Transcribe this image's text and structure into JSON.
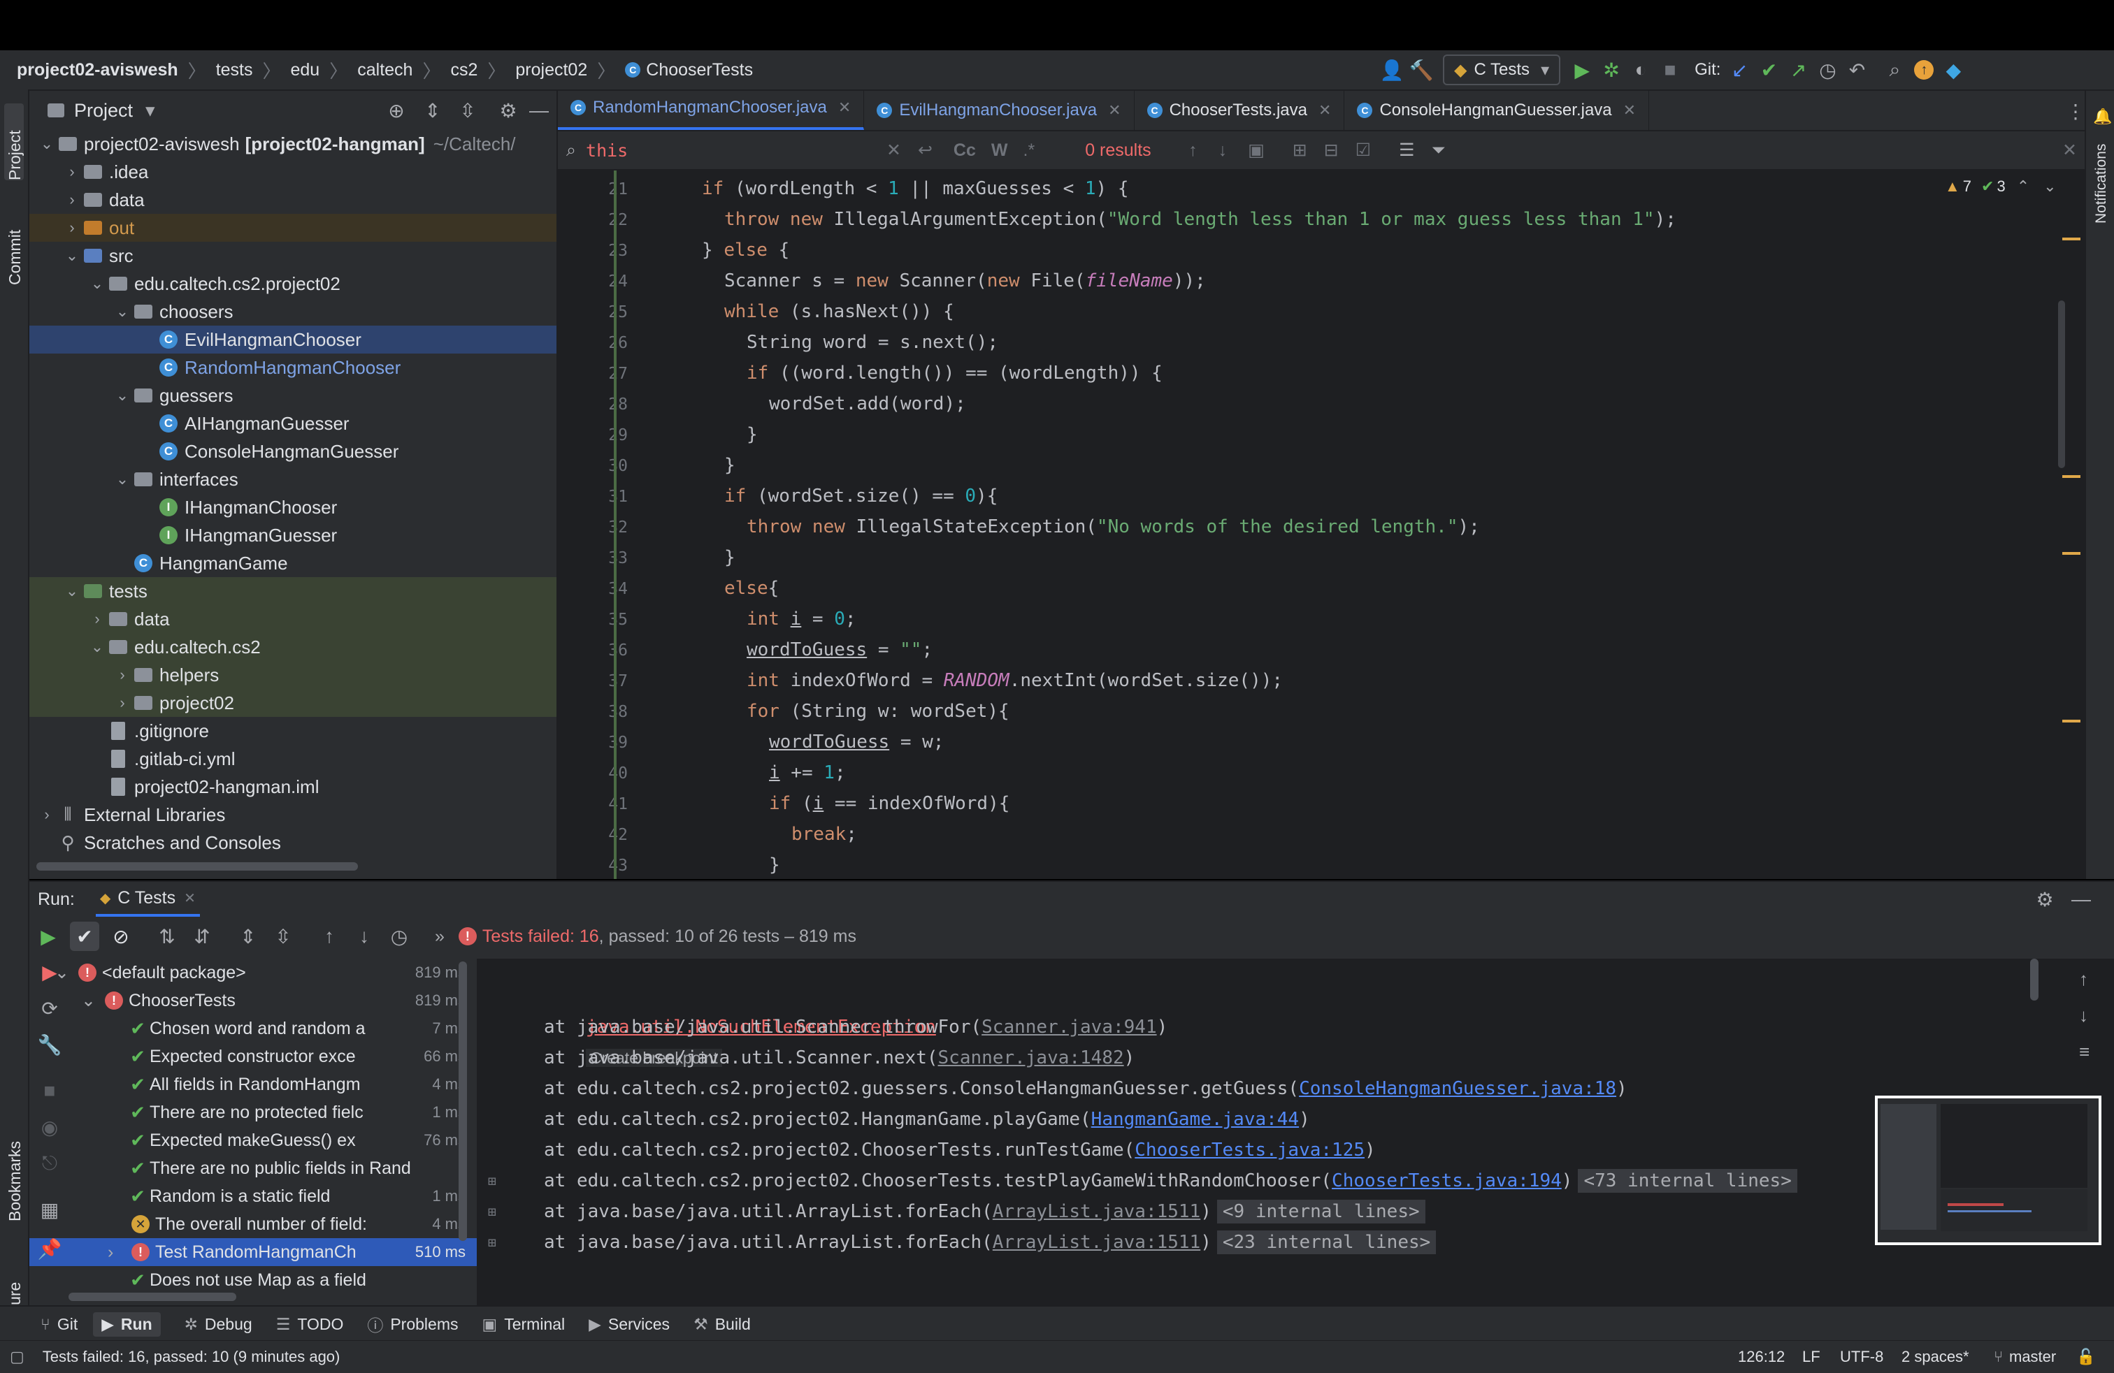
{
  "colors": {
    "accent": "#3574f0",
    "error": "#db5c5c",
    "success": "#5fb85a",
    "background": "#1e1f22",
    "panel": "#2b2d30"
  },
  "navbar": {
    "crumbs": [
      "project02-aviswesh",
      "tests",
      "edu",
      "caltech",
      "cs2",
      "project02",
      "ChooserTests"
    ],
    "run_config": "C Tests",
    "git_label": "Git:"
  },
  "left_strip": {
    "project": "Project",
    "commit": "Commit",
    "bookmarks": "Bookmarks",
    "structure": "Structure"
  },
  "right_strip": {
    "notifications": "Notifications"
  },
  "project_panel": {
    "title": "Project",
    "tree": [
      {
        "label": "project02-aviswesh",
        "extra": "[project02-hangman]",
        "path": "~/Caltech/",
        "indent": 0,
        "chev": "v",
        "icon": "folder"
      },
      {
        "label": ".idea",
        "indent": 1,
        "chev": ">",
        "icon": "folder"
      },
      {
        "label": "data",
        "indent": 1,
        "chev": ">",
        "icon": "folder"
      },
      {
        "label": "out",
        "indent": 1,
        "chev": ">",
        "icon": "folder-orange"
      },
      {
        "label": "src",
        "indent": 1,
        "chev": "v",
        "icon": "folder-blue"
      },
      {
        "label": "edu.caltech.cs2.project02",
        "indent": 2,
        "chev": "v",
        "icon": "folder"
      },
      {
        "label": "choosers",
        "indent": 3,
        "chev": "v",
        "icon": "folder"
      },
      {
        "label": "EvilHangmanChooser",
        "indent": 4,
        "chev": "",
        "icon": "class"
      },
      {
        "label": "RandomHangmanChooser",
        "indent": 4,
        "chev": "",
        "icon": "class"
      },
      {
        "label": "guessers",
        "indent": 3,
        "chev": "v",
        "icon": "folder"
      },
      {
        "label": "AIHangmanGuesser",
        "indent": 4,
        "chev": "",
        "icon": "class"
      },
      {
        "label": "ConsoleHangmanGuesser",
        "indent": 4,
        "chev": "",
        "icon": "class"
      },
      {
        "label": "interfaces",
        "indent": 3,
        "chev": "v",
        "icon": "folder"
      },
      {
        "label": "IHangmanChooser",
        "indent": 4,
        "chev": "",
        "icon": "interface"
      },
      {
        "label": "IHangmanGuesser",
        "indent": 4,
        "chev": "",
        "icon": "interface"
      },
      {
        "label": "HangmanGame",
        "indent": 3,
        "chev": "",
        "icon": "class"
      },
      {
        "label": "tests",
        "indent": 1,
        "chev": "v",
        "icon": "folder-green"
      },
      {
        "label": "data",
        "indent": 2,
        "chev": ">",
        "icon": "folder"
      },
      {
        "label": "edu.caltech.cs2",
        "indent": 2,
        "chev": "v",
        "icon": "folder"
      },
      {
        "label": "helpers",
        "indent": 3,
        "chev": ">",
        "icon": "folder"
      },
      {
        "label": "project02",
        "indent": 3,
        "chev": ">",
        "icon": "folder"
      },
      {
        "label": ".gitignore",
        "indent": 2,
        "chev": "",
        "icon": "file"
      },
      {
        "label": ".gitlab-ci.yml",
        "indent": 2,
        "chev": "",
        "icon": "file"
      },
      {
        "label": "project02-hangman.iml",
        "indent": 2,
        "chev": "",
        "icon": "file"
      },
      {
        "label": "External Libraries",
        "indent": 0,
        "chev": ">",
        "icon": "lib"
      },
      {
        "label": "Scratches and Consoles",
        "indent": 0,
        "chev": "",
        "icon": "scratch"
      }
    ]
  },
  "editor": {
    "tabs": [
      {
        "label": "RandomHangmanChooser.java",
        "active": true
      },
      {
        "label": "EvilHangmanChooser.java",
        "active": false
      },
      {
        "label": "ChooserTests.java",
        "active": false
      },
      {
        "label": "ConsoleHangmanGuesser.java",
        "active": false
      }
    ],
    "search": {
      "query": "this",
      "results": "0 results",
      "case": "Cc",
      "word": "W",
      "regex": ".*"
    },
    "inspections": {
      "warnings": "7",
      "weak": "3"
    },
    "line_numbers": [
      "21",
      "22",
      "23",
      "24",
      "25",
      "26",
      "27",
      "28",
      "29",
      "30",
      "31",
      "32",
      "33",
      "34",
      "35",
      "36",
      "37",
      "38",
      "39",
      "40",
      "41",
      "42",
      "43"
    ]
  },
  "run_panel": {
    "label": "Run:",
    "tab": "C Tests",
    "summary_failed": "Tests failed: 16",
    "summary_rest": ", passed: 10 of 26 tests – 819 ms",
    "tests": [
      {
        "name": "<default package>",
        "time": "819 ms",
        "status": "error",
        "indent": 0
      },
      {
        "name": "ChooserTests",
        "time": "819 ms",
        "status": "error",
        "indent": 1
      },
      {
        "name": "Chosen word and random a",
        "time": "7 ms",
        "status": "pass",
        "indent": 2
      },
      {
        "name": "Expected constructor exce",
        "time": "66 ms",
        "status": "pass",
        "indent": 2
      },
      {
        "name": "All fields in RandomHangm",
        "time": "4 ms",
        "status": "pass",
        "indent": 2
      },
      {
        "name": "There are no protected fielc",
        "time": "1 ms",
        "status": "pass",
        "indent": 2
      },
      {
        "name": "Expected makeGuess() ex",
        "time": "76 ms",
        "status": "pass",
        "indent": 2
      },
      {
        "name": "There are no public fields in Rand",
        "time": "",
        "status": "pass",
        "indent": 2
      },
      {
        "name": "Random is a static field",
        "time": "1 ms",
        "status": "pass",
        "indent": 2
      },
      {
        "name": "The overall number of field:",
        "time": "4 ms",
        "status": "warn",
        "indent": 2
      },
      {
        "name": "Test RandomHangmanCh",
        "time": "510 ms",
        "status": "error",
        "indent": 2,
        "selected": true
      },
      {
        "name": "Does not use Map as a field",
        "time": "",
        "status": "pass",
        "indent": 2
      }
    ],
    "console": {
      "exception": "java.util.NoSuchElementException",
      "create_breakpoint": "Create breakpoint",
      "frames": [
        {
          "text": "at java.base/java.util.Scanner.throwFor(",
          "link": "Scanner.java:941",
          "end": ")",
          "hint": "",
          "own": false
        },
        {
          "text": "at java.base/java.util.Scanner.next(",
          "link": "Scanner.java:1482",
          "end": ")",
          "hint": "",
          "own": false
        },
        {
          "text": "at edu.caltech.cs2.project02.guessers.ConsoleHangmanGuesser.getGuess(",
          "link": "ConsoleHangmanGuesser.java:18",
          "end": ")",
          "hint": "",
          "own": true
        },
        {
          "text": "at edu.caltech.cs2.project02.HangmanGame.playGame(",
          "link": "HangmanGame.java:44",
          "end": ")",
          "hint": "",
          "own": true
        },
        {
          "text": "at edu.caltech.cs2.project02.ChooserTests.runTestGame(",
          "link": "ChooserTests.java:125",
          "end": ")",
          "hint": "",
          "own": true
        },
        {
          "text": "at edu.caltech.cs2.project02.ChooserTests.testPlayGameWithRandomChooser(",
          "link": "ChooserTests.java:194",
          "end": ")",
          "hint": "<73 internal lines>",
          "own": true
        },
        {
          "text": "at java.base/java.util.ArrayList.forEach(",
          "link": "ArrayList.java:1511",
          "end": ")",
          "hint": "<9 internal lines>",
          "own": false
        },
        {
          "text": "at java.base/java.util.ArrayList.forEach(",
          "link": "ArrayList.java:1511",
          "end": ")",
          "hint": "<23 internal lines>",
          "own": false
        }
      ]
    }
  },
  "tool_windows": [
    "Git",
    "Run",
    "Debug",
    "TODO",
    "Problems",
    "Terminal",
    "Services",
    "Build"
  ],
  "status_bar": {
    "message": "Tests failed: 16, passed: 10 (9 minutes ago)",
    "position": "126:12",
    "line_sep": "LF",
    "encoding": "UTF-8",
    "indent": "2 spaces*",
    "branch": "master"
  }
}
